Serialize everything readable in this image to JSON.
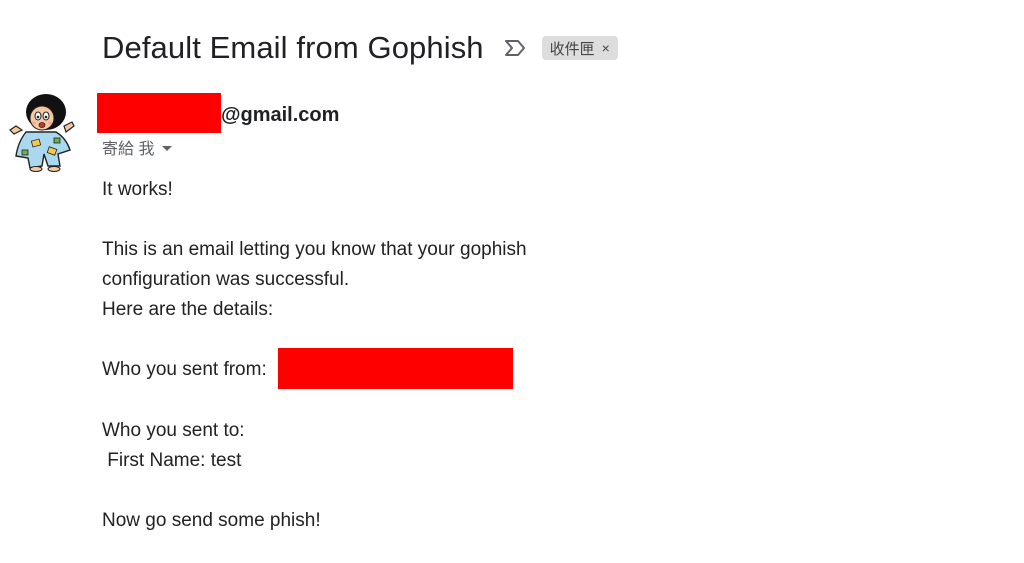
{
  "email": {
    "subject": "Default Email from Gophish",
    "label_chip": "收件匣",
    "label_chip_close": "×",
    "sender_domain": "@gmail.com",
    "to_line": "寄給 我",
    "body": {
      "line1": "It works!",
      "line2": "This is an email letting you know that your gophish",
      "line3": "configuration was successful.",
      "line4": "Here are the details:",
      "line5": "Who you sent from:",
      "line6": "Who you sent to:",
      "line7": " First Name: test",
      "line8": "Now go send some phish!"
    }
  },
  "icons": {
    "importance": "importance-marker-icon",
    "dropdown": "caret-down-icon",
    "avatar": "avatar-cartoon"
  },
  "colors": {
    "redaction": "#ff0000",
    "chip_bg": "#dddddd",
    "text": "#202124",
    "secondary_text": "#5f6368"
  }
}
